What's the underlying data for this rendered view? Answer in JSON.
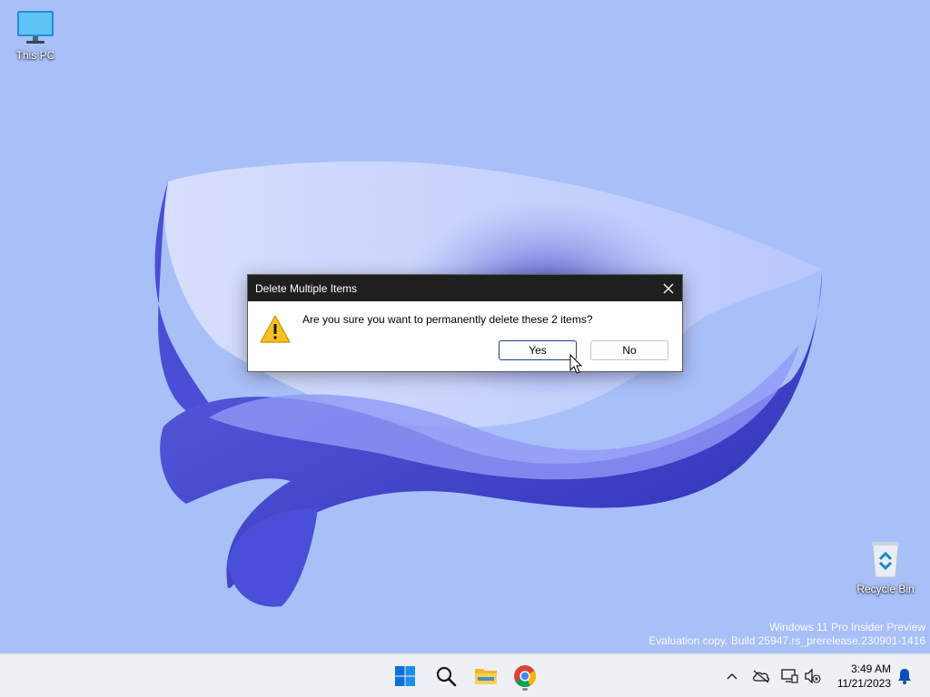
{
  "desktop": {
    "icons": [
      {
        "label": "This PC",
        "icon": "monitor-icon"
      },
      {
        "label": "Recycle Bin",
        "icon": "recycle-bin-icon"
      }
    ],
    "watermark": {
      "line1": "Windows 11 Pro Insider Preview",
      "line2": "Evaluation copy. Build 25947.rs_prerelease.230901-1416"
    }
  },
  "dialog": {
    "title": "Delete Multiple Items",
    "message": "Are you sure you want to permanently delete these 2 items?",
    "icon": "warning-icon",
    "yes_label": "Yes",
    "no_label": "No",
    "close_icon": "close-icon"
  },
  "taskbar": {
    "apps": [
      {
        "name": "start",
        "icon": "windows-start-icon"
      },
      {
        "name": "search",
        "icon": "search-icon"
      },
      {
        "name": "file-explorer",
        "icon": "folder-icon"
      },
      {
        "name": "chrome",
        "icon": "chrome-icon",
        "active": true
      }
    ],
    "tray": {
      "icons": [
        "chevron-up-icon",
        "onedrive-icon",
        "network-icon",
        "volume-icon"
      ],
      "time": "3:49 AM",
      "date": "11/21/2023",
      "notification_icon": "bell-icon"
    }
  },
  "colors": {
    "desktop_bg": "#a9bff8",
    "accent": "#0067c0",
    "dialog_titlebar": "#1f1f1f"
  }
}
